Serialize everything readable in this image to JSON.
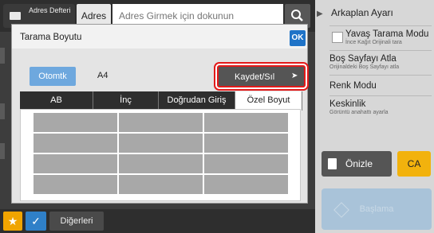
{
  "topbar": {
    "address_book_label": "Adres Defteri",
    "address_button": "Adres",
    "address_placeholder": "Adres Girmek için dokunun",
    "search_icon": "search-icon"
  },
  "right_panel": {
    "title": "Arkaplan Ayarı",
    "items": [
      {
        "label": "Yavaş Tarama Modu",
        "sub": "İnce Kağıt Orijinali tara"
      },
      {
        "label": "Boş Sayfayı Atla",
        "sub": "Orijinaldeki Boş Sayfayı atla"
      },
      {
        "label": "Renk Modu",
        "sub": ""
      },
      {
        "label": "Keskinlik",
        "sub": "Görüntü anahattı ayarla"
      }
    ],
    "preview_label": "Önizle",
    "ca_label": "CA",
    "start_label": "Başlama"
  },
  "bottombar": {
    "others_label": "Diğerleri",
    "star_icon": "star-icon",
    "check_icon": "check-icon"
  },
  "dialog": {
    "title": "Tarama Boyutu",
    "ok_label": "OK",
    "auto_label": "Otomtk",
    "size_value": "A4",
    "save_label": "Kaydet/Sıl",
    "tabs": [
      {
        "label": "AB",
        "active": false
      },
      {
        "label": "İnç",
        "active": false
      },
      {
        "label": "Doğrudan Giriş",
        "active": false
      },
      {
        "label": "Özel Boyut",
        "active": true
      }
    ]
  },
  "colors": {
    "accent_blue": "#1f73c7",
    "highlight_red": "#e31a1a",
    "ca_yellow": "#f2b20d",
    "star_orange": "#f0a400"
  }
}
